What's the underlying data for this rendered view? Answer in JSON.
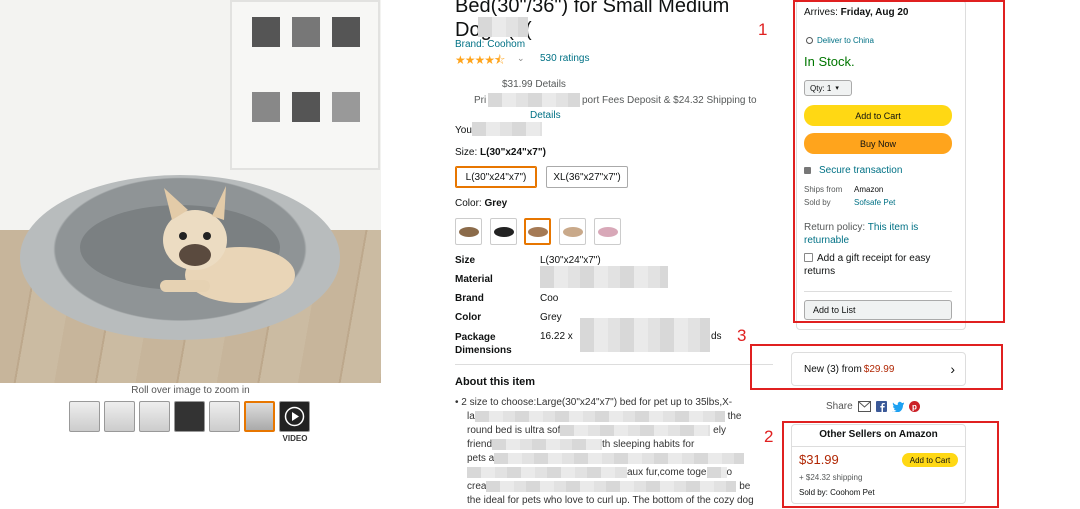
{
  "photo": {
    "roll_over_text": "Roll over image to zoom in",
    "video_label": "VIDEO"
  },
  "title": "Bed(30\"/36\") for Small Medium Dogs (L(",
  "brand": "Brand: Coohom",
  "rating": {
    "stars": "★★★★⯪",
    "chevron": "⌄",
    "count": "530 ratings"
  },
  "pricing": {
    "line1": "$31.99 Details",
    "line2_prefix": "Pri",
    "line2_suffix": "port Fees Deposit & $24.32 Shipping to",
    "line3": "Details",
    "you_save": "You"
  },
  "size": {
    "label": "Size: ",
    "value": "L(30\"x24\"x7\")",
    "options": [
      "L(30\"x24\"x7\")",
      "XL(36\"x27\"x7\")"
    ]
  },
  "color": {
    "label": "Color: ",
    "value": "Grey"
  },
  "specs": {
    "size": {
      "key": "Size",
      "value": "L(30\"x24\"x7\")"
    },
    "material": {
      "key": "Material"
    },
    "brand": {
      "key": "Brand",
      "value": "Coo"
    },
    "color": {
      "key": "Color",
      "value": "Grey"
    },
    "package": {
      "key": "Package Dimensions",
      "value_start": "16.22 x",
      "value_end": "ds"
    }
  },
  "about": {
    "heading": "About this item",
    "bullet1_a": "2 size to choose:Large(30\"x24\"x7\") bed for pet up to 35lbs,X-",
    "bullet1_b": "the",
    "bullet1_c": "round bed is ultra sof",
    "bullet1_d": "ely",
    "bullet1_e": "friend",
    "bullet1_f": "th sleeping habits for",
    "bullet1_g": "pets a",
    "bullet2_a": "aux fur,come toge",
    "bullet2_b": "o",
    "bullet2_c": "crea",
    "bullet2_d": "be",
    "bullet2_e": "the ideal for pets who love to curl up. The bottom of the cozy dog"
  },
  "buybox": {
    "arrives_prefix": "Arrives: ",
    "arrives_date": "Friday, Aug 20",
    "deliver": "Deliver to China",
    "stock": "In Stock.",
    "qty": "Qty: 1",
    "add_to_cart": "Add to Cart",
    "buy_now": "Buy Now",
    "secure": "Secure transaction",
    "ships_from_label": "Ships from",
    "ships_from": "Amazon",
    "sold_by_label": "Sold by",
    "sold_by": "Sofsafe Pet",
    "return_label": "Return policy: ",
    "return_link": "This item is returnable",
    "gift": "Add a gift receipt for easy returns",
    "add_to_list": "Add to List"
  },
  "new_offers": {
    "text": "New (3) from ",
    "price": "$29.99"
  },
  "share": {
    "label": "Share"
  },
  "other_sellers": {
    "title": "Other Sellers on Amazon",
    "price": "$31.99",
    "add_to_cart": "Add to Cart",
    "shipping": "+ $24.32 shipping",
    "sold_by": "Sold by: Coohom Pet"
  },
  "annotations": {
    "n1": "1",
    "n2": "2",
    "n3": "3"
  },
  "colors": {
    "accent": "#e77600",
    "cart": "#ffd814",
    "buy": "#ffa41c",
    "link": "#007185",
    "stock": "#007600",
    "price": "#b12704",
    "annotation": "#e02020"
  }
}
